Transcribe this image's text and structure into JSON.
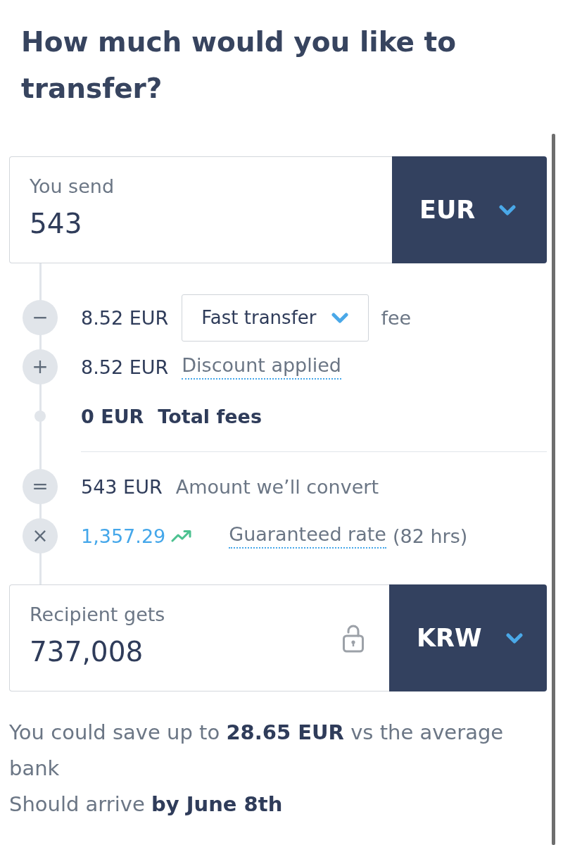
{
  "heading": "How much would you like to transfer?",
  "send": {
    "label": "You send",
    "value": "543",
    "currency": "EUR"
  },
  "fees": [
    {
      "kind": "fee",
      "symbol": "−",
      "amount": "8.52 EUR",
      "option": "Fast transfer",
      "suffix": "fee"
    },
    {
      "kind": "discount",
      "symbol": "+",
      "amount": "8.52 EUR",
      "link": "Discount applied"
    },
    {
      "kind": "total",
      "amount": "0 EUR",
      "label": "Total fees"
    }
  ],
  "conversion": [
    {
      "kind": "convert",
      "symbol": "=",
      "amount": "543 EUR",
      "label": "Amount we’ll convert"
    },
    {
      "kind": "rate",
      "symbol": "×",
      "amount": "1,357.29",
      "link": "Guaranteed rate",
      "note": "(82 hrs)"
    }
  ],
  "receive": {
    "label": "Recipient gets",
    "value": "737,008",
    "currency": "KRW",
    "locked": false
  },
  "savings": "You could save up to **28.65 EUR** vs the average bank",
  "arrival": "Should arrive **by June 8th**"
}
